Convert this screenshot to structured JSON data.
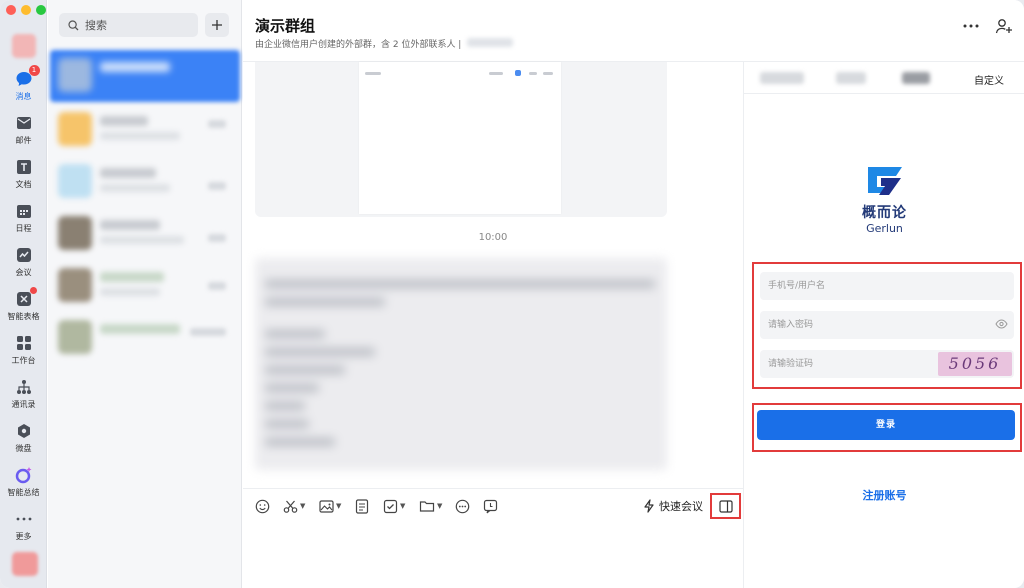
{
  "rail": {
    "items": [
      {
        "label": "消息",
        "badge": "1"
      },
      {
        "label": "邮件"
      },
      {
        "label": "文档"
      },
      {
        "label": "日程"
      },
      {
        "label": "会议"
      },
      {
        "label": "智能表格"
      },
      {
        "label": "工作台"
      },
      {
        "label": "通讯录"
      },
      {
        "label": "微盘"
      },
      {
        "label": "智能总结"
      },
      {
        "label": "更多"
      }
    ]
  },
  "conversation_list": {
    "search_placeholder": "搜索"
  },
  "chat": {
    "title": "演示群组",
    "subtitle": "由企业微信用户创建的外部群，含 2 位外部联系人 |",
    "time_divider": "10:00",
    "toolbar": {
      "meeting_label": "快速会议"
    }
  },
  "panel": {
    "custom_tab": "自定义",
    "brand_cn": "概而论",
    "brand_en": "Gerlun",
    "phone_placeholder": "手机号/用户名",
    "password_placeholder": "请输入密码",
    "captcha_placeholder": "请输验证码",
    "captcha_text": "5056",
    "login_label": "登录",
    "register_label": "注册账号"
  },
  "colors": {
    "accent": "#1a6fe8",
    "highlight": "#e23b3b",
    "badge": "#f04848"
  }
}
